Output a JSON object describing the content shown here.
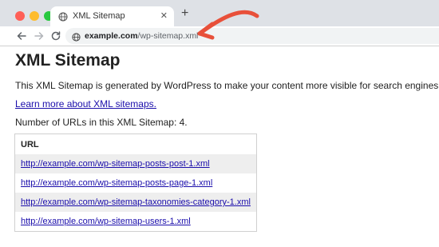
{
  "browser": {
    "tab_title": "XML Sitemap",
    "tab_close": "✕",
    "new_tab": "+",
    "url_host": "example.com",
    "url_path": "/wp-sitemap.xml"
  },
  "page": {
    "heading": "XML Sitemap",
    "intro": "This XML Sitemap is generated by WordPress to make your content more visible for search engines.",
    "learn_more": "Learn more about XML sitemaps.",
    "count_text": "Number of URLs in this XML Sitemap: 4.",
    "table_header": "URL",
    "urls": [
      "http://example.com/wp-sitemap-posts-post-1.xml",
      "http://example.com/wp-sitemap-posts-page-1.xml",
      "http://example.com/wp-sitemap-taxonomies-category-1.xml",
      "http://example.com/wp-sitemap-users-1.xml"
    ]
  },
  "colors": {
    "link": "#1a0dab",
    "annotation_arrow": "#e8503a",
    "row_alt": "#eeeeee"
  }
}
